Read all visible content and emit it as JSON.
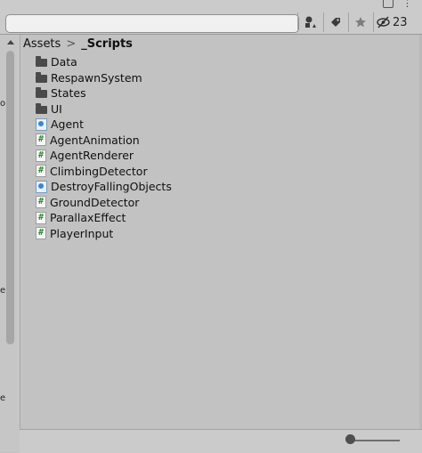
{
  "toolbar": {
    "search_placeholder": "",
    "hidden_packages_count": "23"
  },
  "breadcrumb": {
    "root": "Assets",
    "separator": ">",
    "current": "_Scripts"
  },
  "items": [
    {
      "type": "folder",
      "icon": "folder-icon",
      "label": "Data"
    },
    {
      "type": "folder",
      "icon": "folder-icon",
      "label": "RespawnSystem"
    },
    {
      "type": "folder",
      "icon": "folder-icon",
      "label": "States"
    },
    {
      "type": "folder",
      "icon": "folder-icon",
      "label": "UI"
    },
    {
      "type": "asmdef",
      "icon": "assembly-definition-icon",
      "label": "Agent"
    },
    {
      "type": "script",
      "icon": "csharp-script-icon",
      "label": "AgentAnimation"
    },
    {
      "type": "script",
      "icon": "csharp-script-icon",
      "label": "AgentRenderer"
    },
    {
      "type": "script",
      "icon": "csharp-script-icon",
      "label": "ClimbingDetector"
    },
    {
      "type": "asmdef",
      "icon": "assembly-definition-icon",
      "label": "DestroyFallingObjects"
    },
    {
      "type": "script",
      "icon": "csharp-script-icon",
      "label": "GroundDetector"
    },
    {
      "type": "script",
      "icon": "csharp-script-icon",
      "label": "ParallaxEffect"
    },
    {
      "type": "script",
      "icon": "csharp-script-icon",
      "label": "PlayerInput"
    }
  ],
  "icon_size_slider": {
    "value": 0.0
  },
  "colors": {
    "panel_bg": "#c2c2c2",
    "toolbar_bg": "#cbcbcb",
    "script_hash": "#2f8a32",
    "asmdef_accent": "#3a86d6"
  }
}
